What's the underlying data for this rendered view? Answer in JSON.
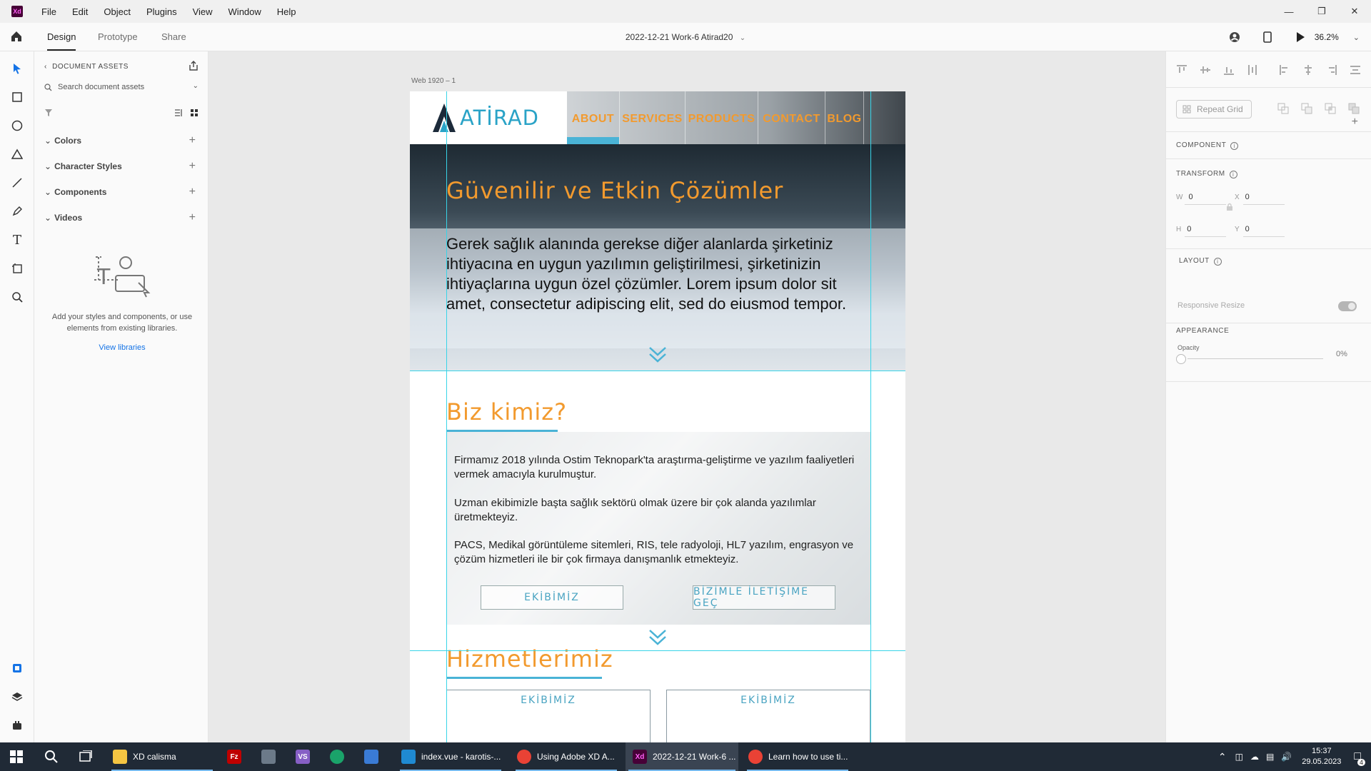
{
  "menu": [
    "File",
    "Edit",
    "Object",
    "Plugins",
    "View",
    "Window",
    "Help"
  ],
  "app_logo": "Xd",
  "toolbar": {
    "tabs": [
      "Design",
      "Prototype",
      "Share"
    ],
    "doc_title": "2022-12-21 Work-6 Atirad20",
    "zoom": "36.2%"
  },
  "assets": {
    "header": "DOCUMENT ASSETS",
    "search_placeholder": "Search document assets",
    "sections": [
      "Colors",
      "Character Styles",
      "Components",
      "Videos"
    ],
    "empty_text": "Add your styles and components, or use elements from existing libraries.",
    "view_libraries": "View libraries"
  },
  "artboard": {
    "label": "Web 1920 – 1",
    "logo": "ATİRAD",
    "nav": [
      "ABOUT",
      "SERVICES",
      "PRODUCTS",
      "CONTACT",
      "BLOG"
    ],
    "hero_title": "Güvenilir ve Etkin Çözümler",
    "hero_text": "Gerek sağlık alanında gerekse diğer alanlarda şirketiniz ihtiyacına en uygun yazılımın geliştirilmesi, şirketinizin ihtiyaçlarına uygun özel çözümler. Lorem ipsum dolor sit amet, consectetur adipiscing elit, sed do eiusmod tempor.",
    "about_title": "Biz kimiz?",
    "about_paragraphs": [
      "Firmamız 2018 yılında Ostim Teknopark'ta araştırma-geliştirme ve yazılım faaliyetleri vermek amacıyla kurulmuştur.",
      "Uzman ekibimizle başta sağlık sektörü olmak üzere bir çok alanda yazılımlar üretmekteyiz.",
      "PACS, Medikal görüntüleme sitemleri, RIS, tele radyoloji, HL7 yazılım, engrasyon ve çözüm hizmetleri ile bir çok firmaya danışmanlık etmekteyiz."
    ],
    "about_buttons": [
      "EKİBİMİZ",
      "BİZİMLE İLETİŞİME GEÇ"
    ],
    "services_title": "Hizmetlerimiz",
    "service_cards": [
      "EKİBİMİZ",
      "EKİBİMİZ"
    ]
  },
  "props": {
    "repeat_grid": "Repeat Grid",
    "component_label": "COMPONENT",
    "transform_label": "TRANSFORM",
    "w": {
      "key": "W",
      "value": "0"
    },
    "x": {
      "key": "X",
      "value": "0"
    },
    "h": {
      "key": "H",
      "value": "0"
    },
    "y": {
      "key": "Y",
      "value": "0"
    },
    "layout_label": "LAYOUT",
    "responsive_resize": "Responsive Resize",
    "appearance_label": "APPEARANCE",
    "opacity_label": "Opacity",
    "opacity_value": "0%"
  },
  "taskbar": {
    "apps": [
      {
        "label": "XD calisma",
        "icon": "folder-icon",
        "color": "#f5c542"
      },
      {
        "label": "",
        "icon": "filezilla-icon",
        "color": "#bf0000"
      },
      {
        "label": "",
        "icon": "paint-icon",
        "color": "#6c7a89"
      },
      {
        "label": "",
        "icon": "visual-studio-icon",
        "color": "#865fc5"
      },
      {
        "label": "",
        "icon": "edge-icon",
        "color": "#1aa36a"
      },
      {
        "label": "",
        "icon": "calculator-icon",
        "color": "#3a7bd5"
      },
      {
        "label": "index.vue - karotis-...",
        "icon": "vscode-icon",
        "color": "#1f8ad2"
      },
      {
        "label": "Using Adobe XD A...",
        "icon": "chrome-icon",
        "color": "#e94235"
      },
      {
        "label": "2022-12-21 Work-6 ...",
        "icon": "xd-icon",
        "color": "#470137"
      },
      {
        "label": "Learn how to use ti...",
        "icon": "chrome-icon",
        "color": "#e94235"
      }
    ],
    "time": "15:37",
    "date": "29.05.2023",
    "notifications": "4"
  },
  "colors": {
    "accent_orange": "#f29a2e",
    "accent_blue": "#4ab3d6",
    "guide_cyan": "#38d4e8"
  }
}
